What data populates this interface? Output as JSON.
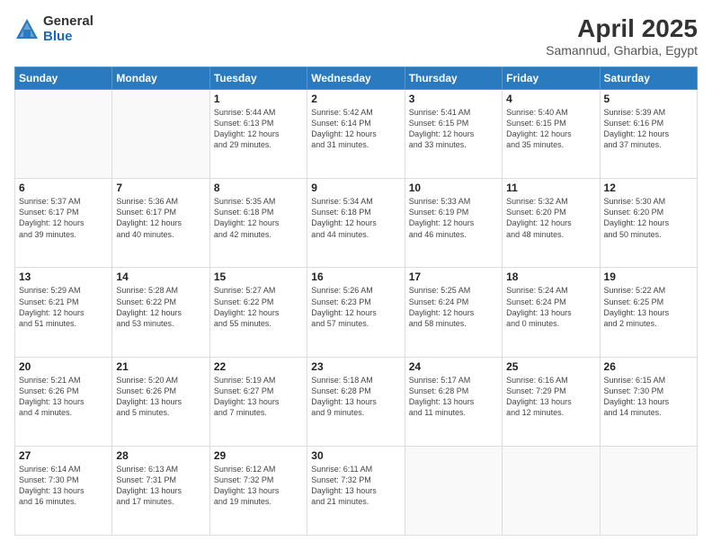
{
  "logo": {
    "general": "General",
    "blue": "Blue"
  },
  "header": {
    "title": "April 2025",
    "subtitle": "Samannud, Gharbia, Egypt"
  },
  "days_of_week": [
    "Sunday",
    "Monday",
    "Tuesday",
    "Wednesday",
    "Thursday",
    "Friday",
    "Saturday"
  ],
  "weeks": [
    [
      {
        "day": "",
        "info": ""
      },
      {
        "day": "",
        "info": ""
      },
      {
        "day": "1",
        "info": "Sunrise: 5:44 AM\nSunset: 6:13 PM\nDaylight: 12 hours\nand 29 minutes."
      },
      {
        "day": "2",
        "info": "Sunrise: 5:42 AM\nSunset: 6:14 PM\nDaylight: 12 hours\nand 31 minutes."
      },
      {
        "day": "3",
        "info": "Sunrise: 5:41 AM\nSunset: 6:15 PM\nDaylight: 12 hours\nand 33 minutes."
      },
      {
        "day": "4",
        "info": "Sunrise: 5:40 AM\nSunset: 6:15 PM\nDaylight: 12 hours\nand 35 minutes."
      },
      {
        "day": "5",
        "info": "Sunrise: 5:39 AM\nSunset: 6:16 PM\nDaylight: 12 hours\nand 37 minutes."
      }
    ],
    [
      {
        "day": "6",
        "info": "Sunrise: 5:37 AM\nSunset: 6:17 PM\nDaylight: 12 hours\nand 39 minutes."
      },
      {
        "day": "7",
        "info": "Sunrise: 5:36 AM\nSunset: 6:17 PM\nDaylight: 12 hours\nand 40 minutes."
      },
      {
        "day": "8",
        "info": "Sunrise: 5:35 AM\nSunset: 6:18 PM\nDaylight: 12 hours\nand 42 minutes."
      },
      {
        "day": "9",
        "info": "Sunrise: 5:34 AM\nSunset: 6:18 PM\nDaylight: 12 hours\nand 44 minutes."
      },
      {
        "day": "10",
        "info": "Sunrise: 5:33 AM\nSunset: 6:19 PM\nDaylight: 12 hours\nand 46 minutes."
      },
      {
        "day": "11",
        "info": "Sunrise: 5:32 AM\nSunset: 6:20 PM\nDaylight: 12 hours\nand 48 minutes."
      },
      {
        "day": "12",
        "info": "Sunrise: 5:30 AM\nSunset: 6:20 PM\nDaylight: 12 hours\nand 50 minutes."
      }
    ],
    [
      {
        "day": "13",
        "info": "Sunrise: 5:29 AM\nSunset: 6:21 PM\nDaylight: 12 hours\nand 51 minutes."
      },
      {
        "day": "14",
        "info": "Sunrise: 5:28 AM\nSunset: 6:22 PM\nDaylight: 12 hours\nand 53 minutes."
      },
      {
        "day": "15",
        "info": "Sunrise: 5:27 AM\nSunset: 6:22 PM\nDaylight: 12 hours\nand 55 minutes."
      },
      {
        "day": "16",
        "info": "Sunrise: 5:26 AM\nSunset: 6:23 PM\nDaylight: 12 hours\nand 57 minutes."
      },
      {
        "day": "17",
        "info": "Sunrise: 5:25 AM\nSunset: 6:24 PM\nDaylight: 12 hours\nand 58 minutes."
      },
      {
        "day": "18",
        "info": "Sunrise: 5:24 AM\nSunset: 6:24 PM\nDaylight: 13 hours\nand 0 minutes."
      },
      {
        "day": "19",
        "info": "Sunrise: 5:22 AM\nSunset: 6:25 PM\nDaylight: 13 hours\nand 2 minutes."
      }
    ],
    [
      {
        "day": "20",
        "info": "Sunrise: 5:21 AM\nSunset: 6:26 PM\nDaylight: 13 hours\nand 4 minutes."
      },
      {
        "day": "21",
        "info": "Sunrise: 5:20 AM\nSunset: 6:26 PM\nDaylight: 13 hours\nand 5 minutes."
      },
      {
        "day": "22",
        "info": "Sunrise: 5:19 AM\nSunset: 6:27 PM\nDaylight: 13 hours\nand 7 minutes."
      },
      {
        "day": "23",
        "info": "Sunrise: 5:18 AM\nSunset: 6:28 PM\nDaylight: 13 hours\nand 9 minutes."
      },
      {
        "day": "24",
        "info": "Sunrise: 5:17 AM\nSunset: 6:28 PM\nDaylight: 13 hours\nand 11 minutes."
      },
      {
        "day": "25",
        "info": "Sunrise: 6:16 AM\nSunset: 7:29 PM\nDaylight: 13 hours\nand 12 minutes."
      },
      {
        "day": "26",
        "info": "Sunrise: 6:15 AM\nSunset: 7:30 PM\nDaylight: 13 hours\nand 14 minutes."
      }
    ],
    [
      {
        "day": "27",
        "info": "Sunrise: 6:14 AM\nSunset: 7:30 PM\nDaylight: 13 hours\nand 16 minutes."
      },
      {
        "day": "28",
        "info": "Sunrise: 6:13 AM\nSunset: 7:31 PM\nDaylight: 13 hours\nand 17 minutes."
      },
      {
        "day": "29",
        "info": "Sunrise: 6:12 AM\nSunset: 7:32 PM\nDaylight: 13 hours\nand 19 minutes."
      },
      {
        "day": "30",
        "info": "Sunrise: 6:11 AM\nSunset: 7:32 PM\nDaylight: 13 hours\nand 21 minutes."
      },
      {
        "day": "",
        "info": ""
      },
      {
        "day": "",
        "info": ""
      },
      {
        "day": "",
        "info": ""
      }
    ]
  ]
}
